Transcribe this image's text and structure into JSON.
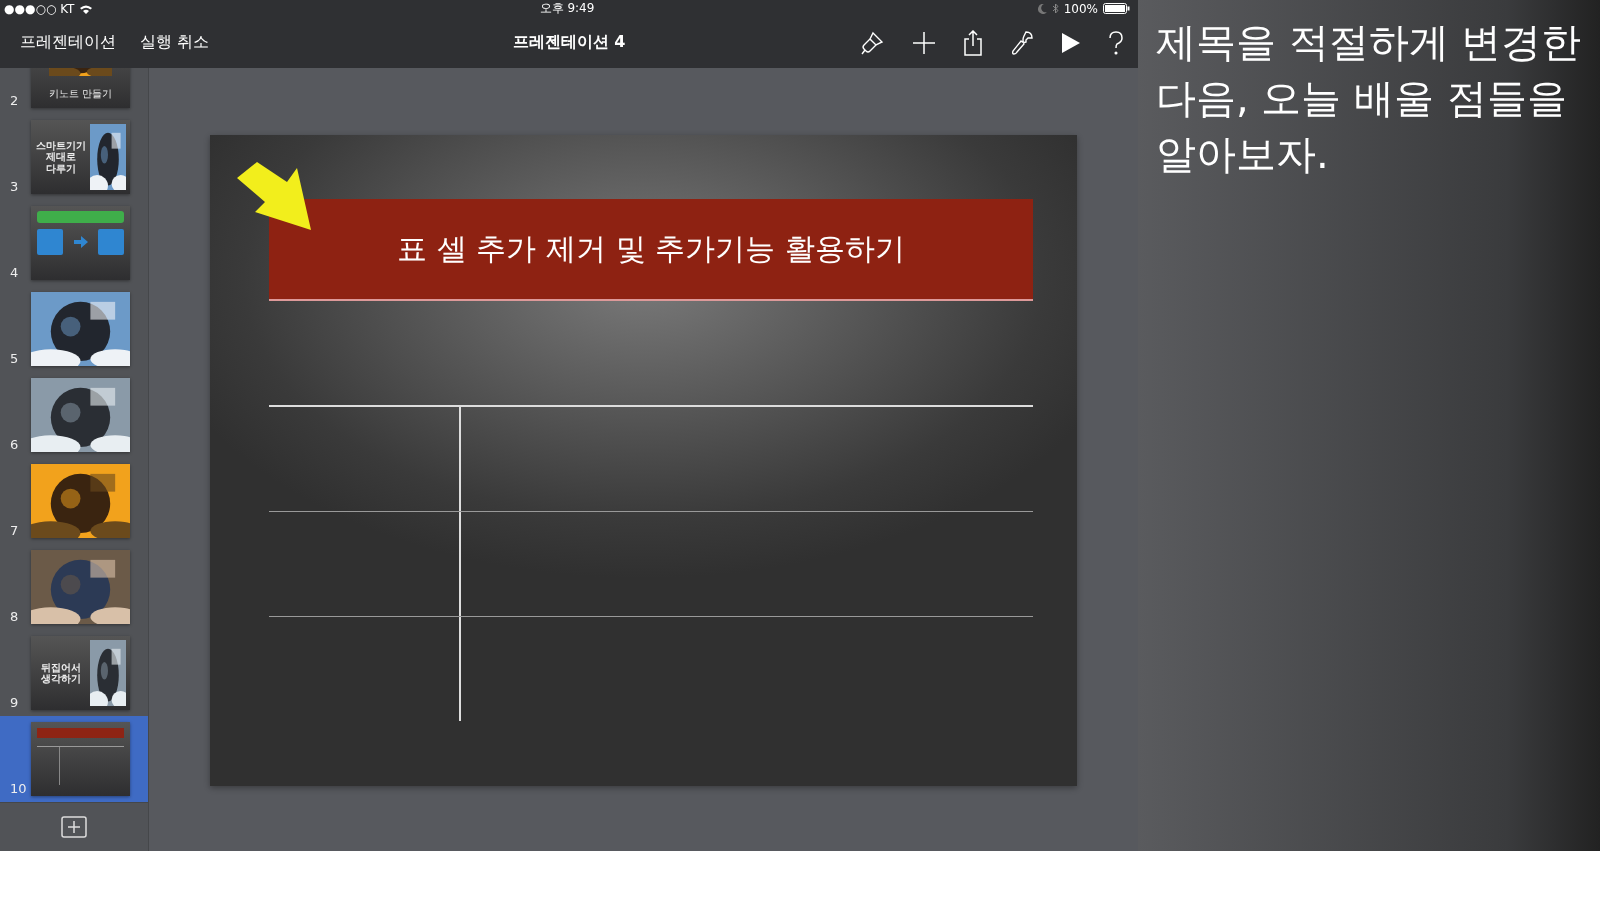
{
  "status_bar": {
    "carrier": "●●●○○ KT",
    "time": "오후 9:49",
    "battery": "100%"
  },
  "toolbar": {
    "left_buttons": [
      "프레젠테이션",
      "실행 취소"
    ],
    "title": "프레젠테이션 4"
  },
  "slides": [
    {
      "number": "2",
      "kind": "picture-caption",
      "title": "키노트 만들기",
      "selected": false
    },
    {
      "number": "3",
      "kind": "text-picture",
      "title": "스마트기기 제대로 다루기",
      "selected": false
    },
    {
      "number": "4",
      "kind": "diagram",
      "selected": false
    },
    {
      "number": "5",
      "kind": "picture",
      "selected": false
    },
    {
      "number": "6",
      "kind": "picture",
      "selected": false
    },
    {
      "number": "7",
      "kind": "picture",
      "selected": false
    },
    {
      "number": "8",
      "kind": "picture",
      "selected": false
    },
    {
      "number": "9",
      "kind": "text-picture",
      "title": "뒤집어서 생각하기",
      "selected": false
    },
    {
      "number": "10",
      "kind": "table",
      "selected": true
    }
  ],
  "slide": {
    "title": "표 셀 추가 제거 및 추가기능 활용하기",
    "table": {
      "rows": [
        {
          "cells": [
            {
              "kind": "blank"
            },
            {
              "kind": "blank"
            }
          ]
        },
        {
          "cells": [
            {
              "kind": "blank"
            },
            {
              "kind": "blank"
            }
          ]
        },
        {
          "cells": [
            {
              "kind": "blank"
            },
            {
              "kind": "blank"
            }
          ]
        }
      ]
    }
  },
  "caption": "제목을 적절하게 변경한 다음, 오늘 배울 점들을 알아보자."
}
